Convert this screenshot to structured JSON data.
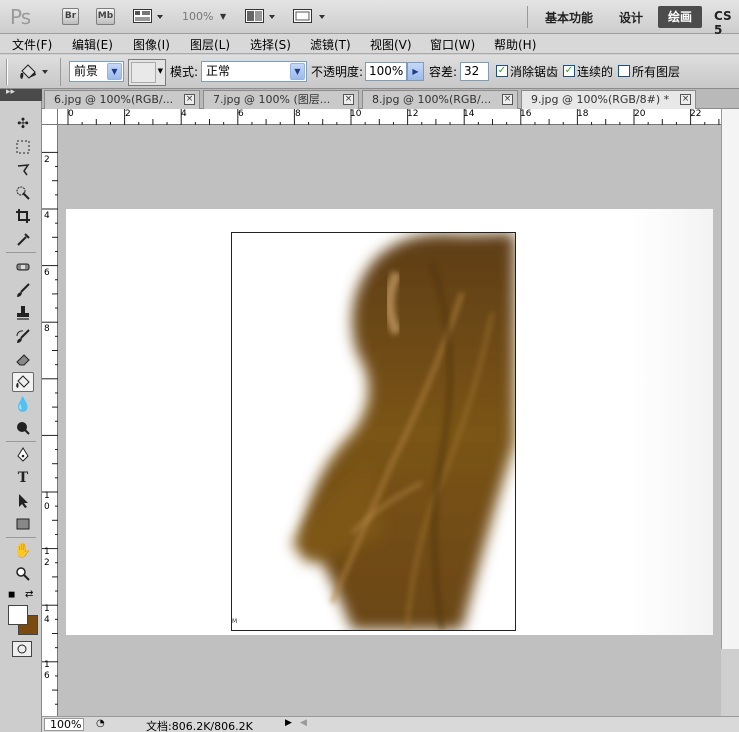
{
  "app": {
    "logo": "Ps",
    "bridge_label": "Br",
    "minibridge_label": "Mb",
    "zoom_level": "100%",
    "workspaces": [
      "基本功能",
      "设计",
      "绘画",
      "CS 5"
    ],
    "active_workspace": "绘画"
  },
  "menu": [
    "文件(F)",
    "编辑(E)",
    "图像(I)",
    "图层(L)",
    "选择(S)",
    "滤镜(T)",
    "视图(V)",
    "窗口(W)",
    "帮助(H)"
  ],
  "options": {
    "fill_source": "前景",
    "mode_label": "模式:",
    "mode_value": "正常",
    "opacity_label": "不透明度:",
    "opacity_value": "100%",
    "tolerance_label": "容差:",
    "tolerance_value": "32",
    "antialias_label": "消除锯齿",
    "antialias_checked": true,
    "contiguous_label": "连续的",
    "contiguous_checked": true,
    "all_layers_label": "所有图层",
    "all_layers_checked": false
  },
  "tabs": [
    {
      "label": "6.jpg @ 100%(RGB/...",
      "active": false
    },
    {
      "label": "7.jpg @ 100% (图层...",
      "active": false
    },
    {
      "label": "8.jpg @ 100%(RGB/...",
      "active": false
    },
    {
      "label": "9.jpg @ 100%(RGB/8#) *",
      "active": true
    }
  ],
  "rulers": {
    "horizontal": [
      "0",
      "2",
      "4",
      "6",
      "8",
      "10",
      "12",
      "14",
      "16",
      "18",
      "20",
      "22"
    ],
    "vertical": [
      "2",
      "4",
      "6",
      "8",
      "1 0",
      "1 2",
      "1 4",
      "1 6"
    ]
  },
  "colors": {
    "foreground": "#ffffff",
    "background": "#7a4a10",
    "hair_dark": "#6b4612",
    "hair_mid": "#8c6420",
    "hair_light": "#c9a06a"
  },
  "status": {
    "zoom": "100%",
    "doc_info": "文档:806.2K/806.2K"
  },
  "canvas_mark": "M"
}
